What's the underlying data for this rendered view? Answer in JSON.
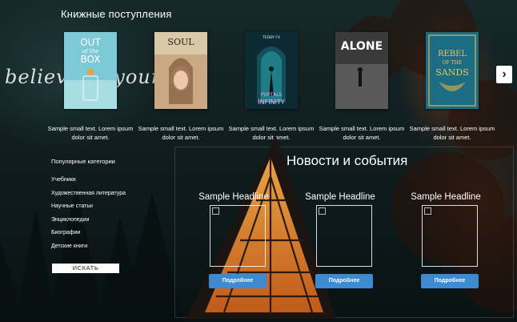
{
  "header": {
    "title": "Книжные поступления",
    "script_text": "believe in yourself"
  },
  "books": [
    {
      "cover": "out-of-the-box",
      "title_lines": [
        "OUT",
        "of the",
        "BOX"
      ],
      "caption": "Sample small text. Lorem ipsum dolor sit amet."
    },
    {
      "cover": "soul",
      "title_lines": [
        "SOUL"
      ],
      "caption": "Sample small text. Lorem ipsum dolor sit amet."
    },
    {
      "cover": "portals-to-infinity",
      "title_lines": [
        "PORTALS",
        "INFINITY"
      ],
      "author": "TEDDY FV",
      "caption": "Sample small text. Lorem ipsum dolor sit amet."
    },
    {
      "cover": "alone",
      "title_lines": [
        "ALONE"
      ],
      "caption": "Sample small text. Lorem ipsum dolor sit amet."
    },
    {
      "cover": "rebel-of-the-sands",
      "title_lines": [
        "REBEL",
        "OF THE",
        "SANDS"
      ],
      "caption": "Sample small text. Lorem ipsum dolor sit amet."
    }
  ],
  "carousel": {
    "next_icon": "chevron-right-icon",
    "next_glyph": "›"
  },
  "categories": {
    "title": "Популярные категории",
    "items": [
      "Учебники",
      "Художественная литература",
      "Научные статьи",
      "Энциклопедии",
      "Биографии",
      "Детские книги"
    ],
    "search_label": "ИСКАТЬ"
  },
  "news": {
    "title": "Новости и события",
    "cards": [
      {
        "headline": "Sample Headline",
        "button": "Подробнее"
      },
      {
        "headline": "Sample Headline",
        "button": "Подробнее"
      },
      {
        "headline": "Sample Headline",
        "button": "Подробнее"
      }
    ]
  },
  "colors": {
    "button_blue": "#3d8ad1",
    "background": "#0e1b1d"
  }
}
